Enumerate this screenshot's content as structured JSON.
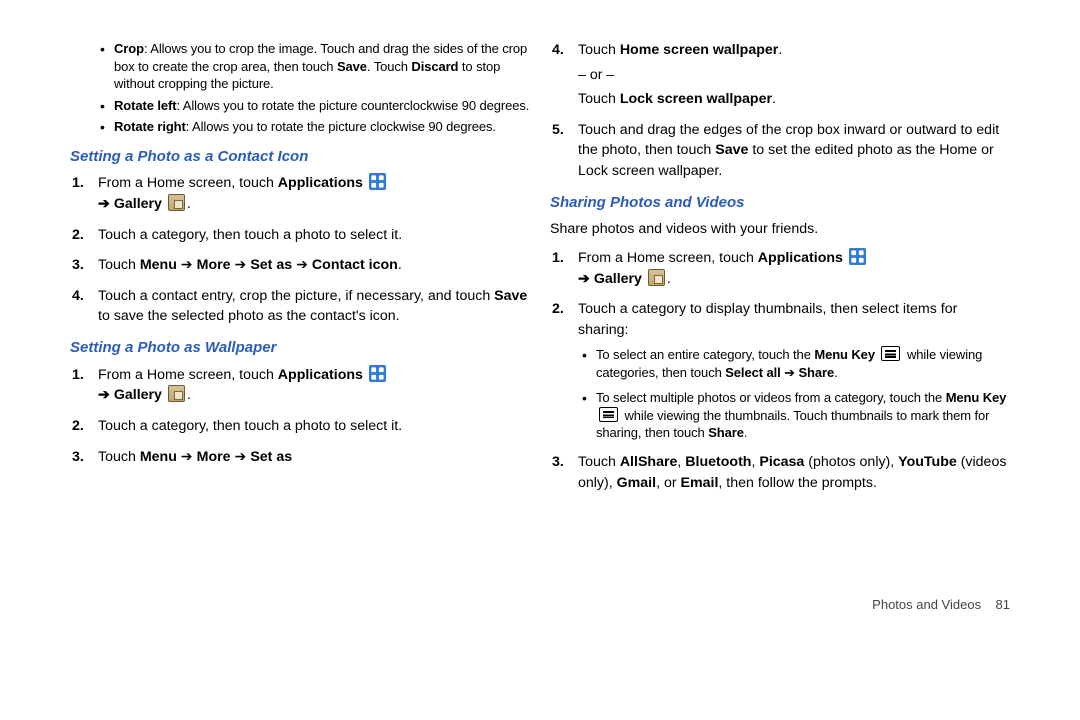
{
  "left": {
    "crop": "Crop: Allows you to crop the image. Touch and drag the sides of the crop box to create the crop area, then touch Save. Touch Discard to stop without cropping the picture.",
    "rotl": "Rotate left: Allows you to rotate the picture counterclockwise 90 degrees.",
    "rotr": "Rotate right: Allows you to rotate the picture clockwise 90 degrees.",
    "h1": "Setting a Photo as a Contact Icon",
    "s1_1a": "From a Home screen, touch ",
    "s1_1b": "Applications",
    "s1_1c": "➔ Gallery",
    "s1_2": "Touch a category, then touch a photo to select it.",
    "s1_3": "Touch Menu ➔ More ➔ Set as ➔ Contact icon.",
    "s1_4": "Touch a contact entry, crop the picture, if necessary, and touch Save to save the selected photo as the contact's icon.",
    "h2": "Setting a Photo as Wallpaper",
    "s2_1a": "From a Home screen, touch ",
    "s2_1b": "Applications",
    "s2_1c": "➔ Gallery",
    "s2_2": "Touch a category, then touch a photo to select it.",
    "s2_3": "Touch Menu ➔ More ➔ Set as"
  },
  "right": {
    "s2_4a": "Touch ",
    "s2_4b": "Home screen wallpaper",
    "s2_4c": ".",
    "s2_4d": "– or –",
    "s2_4e": "Touch ",
    "s2_4f": "Lock screen wallpaper",
    "s2_4g": ".",
    "s2_5": "Touch and drag the edges of the crop box inward or outward to edit the photo, then touch Save to set the edited photo as the Home or Lock screen wallpaper.",
    "h3": "Sharing Photos and Videos",
    "intro": "Share photos and videos with your friends.",
    "s3_1a": "From a Home screen, touch ",
    "s3_1b": "Applications",
    "s3_1c": "➔ Gallery",
    "s3_2": "Touch a category to display thumbnails, then select items for sharing:",
    "b1": "To select an entire category, touch the Menu Key while viewing categories, then touch Select all ➔ Share.",
    "b2": "To select multiple photos or videos from a category, touch the Menu Key while viewing the thumbnails. Touch thumbnails to mark them for sharing, then touch Share.",
    "s3_3": "Touch AllShare, Bluetooth, Picasa (photos only), YouTube (videos only), Gmail, or Email, then follow the prompts."
  },
  "footer_label": "Photos and Videos",
  "footer_page": "81"
}
